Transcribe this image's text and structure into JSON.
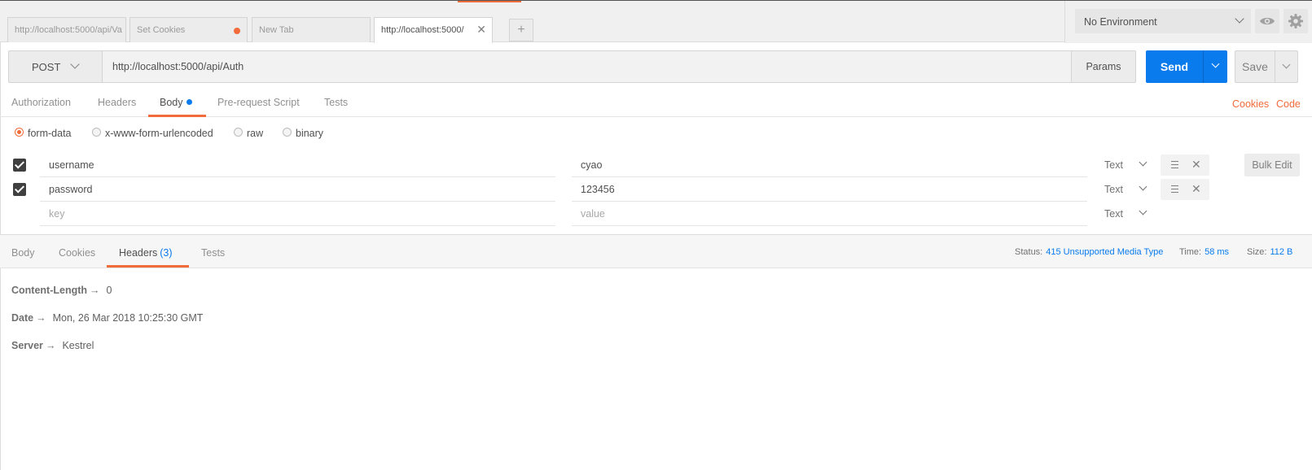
{
  "tabs": [
    {
      "label": "http://localhost:5000/api/Va",
      "state": "inactive"
    },
    {
      "label": "Set Cookies",
      "state": "unsaved"
    },
    {
      "label": "New Tab",
      "state": "inactive"
    },
    {
      "label": "http://localhost:5000/",
      "state": "active"
    }
  ],
  "new_tab_label": "+",
  "environment": {
    "selected": "No Environment"
  },
  "request": {
    "method": "POST",
    "url": "http://localhost:5000/api/Auth",
    "params_label": "Params",
    "send_label": "Send",
    "save_label": "Save"
  },
  "request_tabs": [
    {
      "label": "Authorization"
    },
    {
      "label": "Headers"
    },
    {
      "label": "Body"
    },
    {
      "label": "Pre-request Script"
    },
    {
      "label": "Tests"
    }
  ],
  "active_request_tab": "Body",
  "links": {
    "cookies": "Cookies",
    "code": "Code"
  },
  "body_types": [
    {
      "label": "form-data",
      "checked": true
    },
    {
      "label": "x-www-form-urlencoded",
      "checked": false
    },
    {
      "label": "raw",
      "checked": false
    },
    {
      "label": "binary",
      "checked": false
    }
  ],
  "form_rows": [
    {
      "key": "username",
      "value": "cyao",
      "type": "Text",
      "enabled": true
    },
    {
      "key": "password",
      "value": "123456",
      "type": "Text",
      "enabled": true
    }
  ],
  "new_row": {
    "key_placeholder": "key",
    "value_placeholder": "value",
    "type": "Text"
  },
  "bulk_edit_label": "Bulk Edit",
  "response": {
    "tabs": [
      {
        "label": "Body"
      },
      {
        "label": "Cookies"
      },
      {
        "label": "Headers",
        "count": "(3)"
      },
      {
        "label": "Tests"
      }
    ],
    "status_label": "Status:",
    "status": "415 Unsupported Media Type",
    "time_label": "Time:",
    "time": "58 ms",
    "size_label": "Size:",
    "size": "112 B",
    "arrow": "→",
    "headers": [
      {
        "name": "Content-Length",
        "value": "0"
      },
      {
        "name": "Date",
        "value": "Mon, 26 Mar 2018 10:25:30 GMT"
      },
      {
        "name": "Server",
        "value": "Kestrel"
      }
    ]
  },
  "colors": {
    "accent": "#f26b3a",
    "send": "#097bed",
    "link_blue": "#097bed"
  },
  "icons": {
    "eye": "eye-icon",
    "gear": "gear-icon",
    "close": "close-icon",
    "menu": "menu-icon",
    "delete": "delete-icon"
  }
}
